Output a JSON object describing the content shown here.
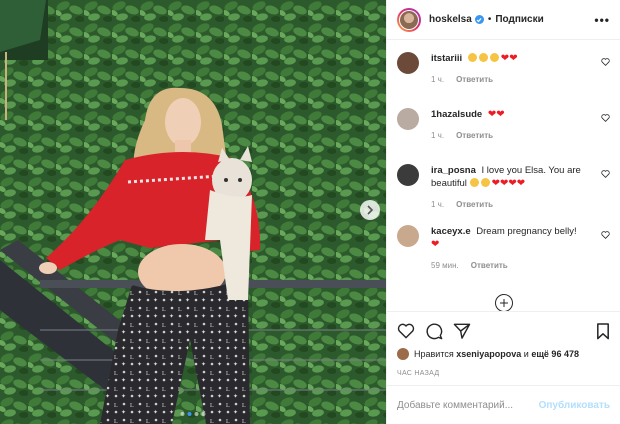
{
  "header": {
    "username": "hoskelsa",
    "bullet": "•",
    "follow_label": "Подписки",
    "more_label": "•••"
  },
  "comments": [
    {
      "user": "itstariii",
      "text": "",
      "emojis": [
        "grimace",
        "grimace",
        "grimace",
        "heart",
        "heart"
      ],
      "time": "1 ч.",
      "reply": "Ответить",
      "avatar_color": "#6b4a3a"
    },
    {
      "user": "1hazalsude",
      "text": "",
      "emojis": [
        "heart",
        "heart"
      ],
      "time": "1 ч.",
      "reply": "Ответить",
      "avatar_color": "#b9aaa2"
    },
    {
      "user": "ira_posna",
      "text": "I love you Elsa. You are beautiful",
      "emojis": [
        "cry",
        "cry",
        "heart",
        "heart",
        "heart",
        "heart"
      ],
      "time": "1 ч.",
      "reply": "Ответить",
      "avatar_color": "#3b3b3b"
    },
    {
      "user": "kaceyx.e",
      "text": "Dream pregnancy belly!",
      "emojis": [
        "heart"
      ],
      "time": "59 мин.",
      "reply": "Ответить",
      "avatar_color": "#c9a98e"
    }
  ],
  "likes": {
    "prefix": "Нравится",
    "first_user": "xseniyapopova",
    "middle": "и",
    "rest": "ещё 96 478"
  },
  "time_ago": "ЧАС НАЗАД",
  "comment_input": {
    "placeholder": "Добавьте комментарий...",
    "value": ""
  },
  "publish_label": "Опубликовать",
  "carousel": {
    "total": 4,
    "active": 1
  },
  "colors": {
    "accent": "#3897f0",
    "heart": "#ed1c24",
    "muted": "#8e8e8e"
  }
}
